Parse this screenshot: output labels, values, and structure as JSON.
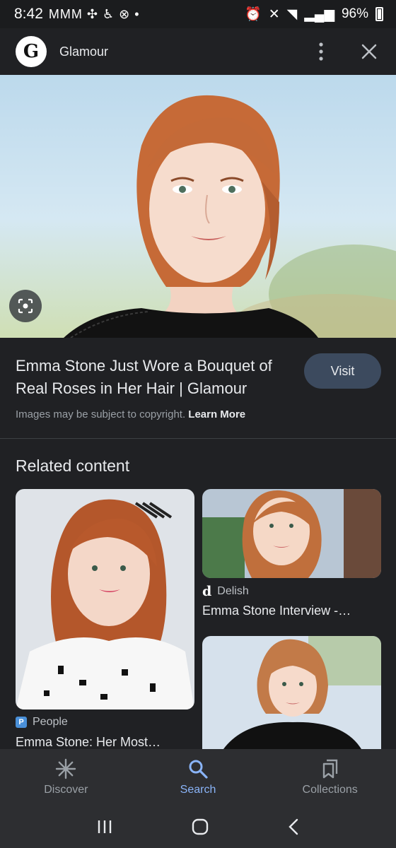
{
  "status_bar": {
    "time": "8:42",
    "notification_icons": "MMM",
    "battery": "96%"
  },
  "header": {
    "source_logo_letter": "G",
    "source_name": "Glamour"
  },
  "result": {
    "title": "Emma Stone Just Wore a Bouquet of Real Roses in Her Hair | Glamour",
    "visit_label": "Visit",
    "copyright_text": "Images may be subject to copyright.",
    "learn_more": "Learn More"
  },
  "related": {
    "title": "Related content",
    "cards": [
      {
        "source": "People",
        "caption": "Emma Stone: Her Most…"
      },
      {
        "source": "Delish",
        "caption": "Emma Stone Interview -…"
      }
    ]
  },
  "bottom_nav": {
    "items": [
      {
        "label": "Discover",
        "icon": "asterisk-icon"
      },
      {
        "label": "Search",
        "icon": "search-icon",
        "active": true
      },
      {
        "label": "Collections",
        "icon": "collections-icon"
      }
    ]
  },
  "colors": {
    "background": "#202124",
    "accent": "#8ab4f8",
    "visit_button": "#3c4a5e"
  }
}
